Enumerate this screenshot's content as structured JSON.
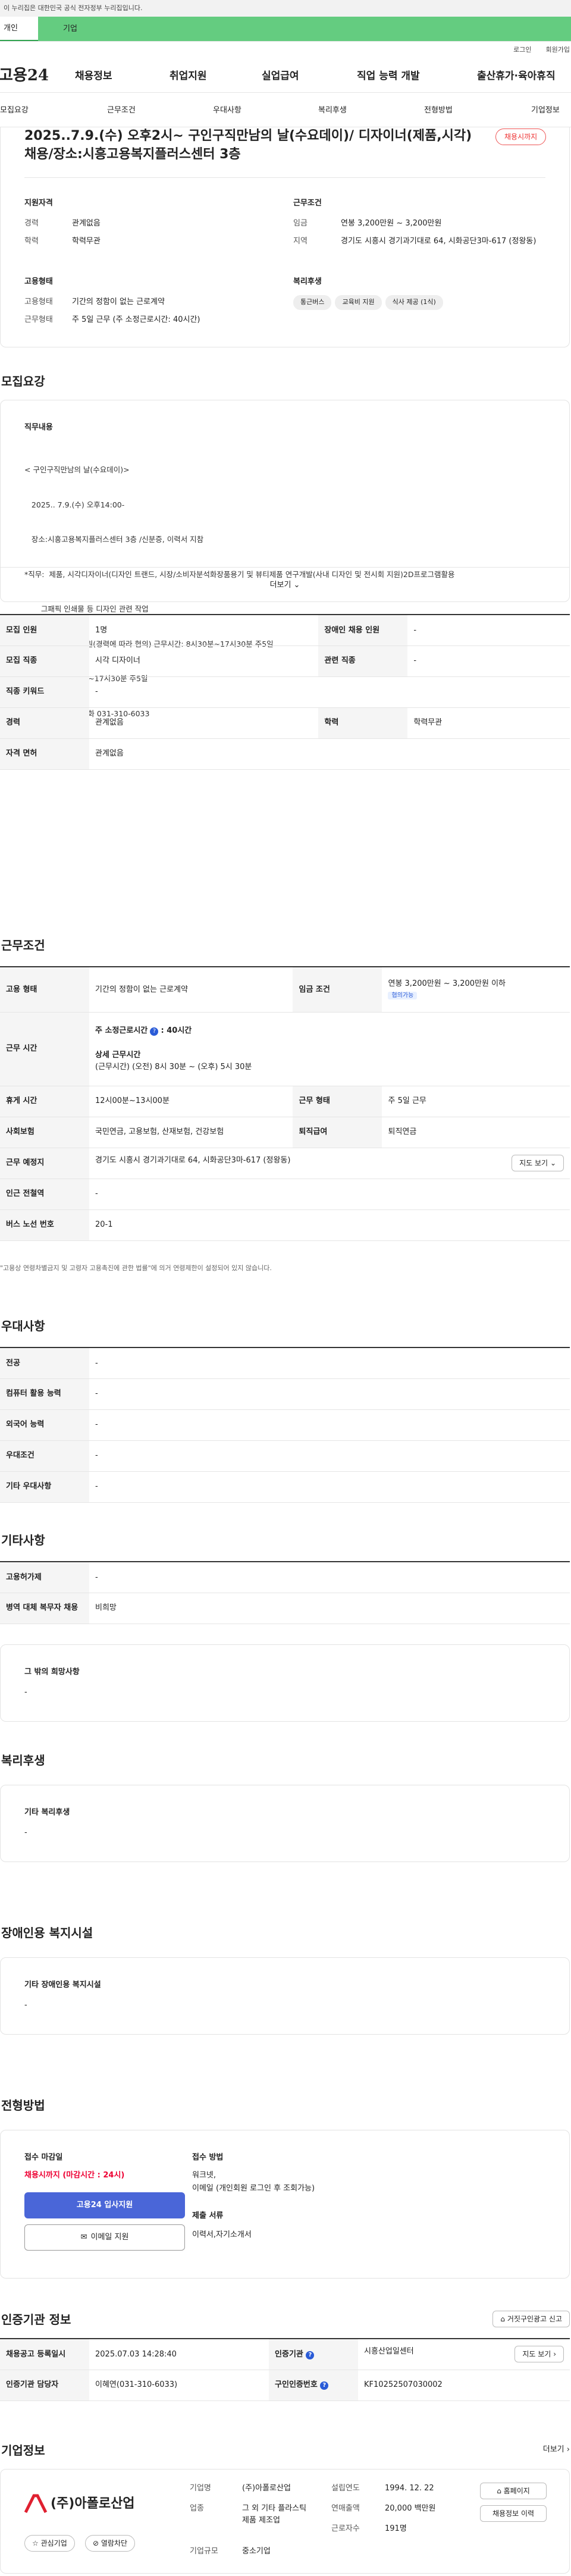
{
  "gov_banner": "이 누리집은 대한민국 공식 전자정부 누리집입니다.",
  "top_tabs": {
    "individual": "개인",
    "business": "기업"
  },
  "util": {
    "login": "로그인",
    "join": "회원가입"
  },
  "logo": "고용24",
  "gnb": [
    "채용정보",
    "취업지원",
    "실업급여",
    "직업 능력 개발",
    "출산휴가·육아휴직"
  ],
  "snb": [
    "모집요강",
    "근무조건",
    "우대사항",
    "복리후생",
    "전형방법",
    "기업정보"
  ],
  "summary": {
    "title": "2025..7.9.(수) 오후2시~ 구인구직만남의 날(수요데이)/ 디자이너(제품,시각) 채용/장소:시흥고용복지플러스센터 3층",
    "badge": "채용시까지",
    "qual_title": "지원자격",
    "qual": [
      {
        "k": "경력",
        "v": "관계없음"
      },
      {
        "k": "학력",
        "v": "학력무관"
      }
    ],
    "cond_title": "근무조건",
    "cond": [
      {
        "k": "임금",
        "v": "연봉 3,200만원 ~ 3,200만원"
      },
      {
        "k": "지역",
        "v": "경기도 시흥시 경기과기대로 64, 시화공단3마-617 (정왕동)"
      }
    ],
    "emp_title": "고용형태",
    "emp": [
      {
        "k": "고용형태",
        "v": "기간의 정함이 없는 근로계약"
      },
      {
        "k": "근무형태",
        "v": "주 5일 근무 (주 소정근로시간: 40시간)"
      }
    ],
    "welfare_title": "복리후생",
    "welfare_chips": [
      "통근버스",
      "교육비 지원",
      "식사 제공 (1식)"
    ]
  },
  "recruit": {
    "section": "모집요강",
    "duty_title": "직무내용",
    "duty_lines": [
      "< 구인구직만남의 날(수요데이)>",
      "   2025.. 7.9.(수) 오후14:00-",
      "   장소:시흥고용복지플러스센터 3층 /신분증, 이력서 지참",
      "*직무:  제품, 시각디자이너(디자인 트랜드, 시장/소비자분석화장품용기 및 뷰티제품 연구개발(사내 디자인 및 전시회 지원)2D프로그램활용",
      "       그패픽 인쇄물 등 디자인 관련 작업",
      "*급여: 연봉3200만원(경력에 따라 협의) 근무시간: 8시30분~17시30분 주5일",
      "*근무시간: 8시30분~17시30분 주5일",
      "*통근버스 유/문의전화 031-310-6033"
    ],
    "more": "더보기",
    "rows": [
      [
        "모집 인원",
        "1명",
        "장애인 채용 인원",
        "-"
      ],
      [
        "모집 직종",
        "시각 디자이너",
        "관련 직종",
        "-"
      ],
      [
        "직종 키워드",
        "-",
        "",
        ""
      ],
      [
        "경력",
        "관계없음",
        "학력",
        "학력무관"
      ],
      [
        "자격 면허",
        "관계없음",
        "",
        ""
      ]
    ]
  },
  "work": {
    "section": "근무조건",
    "employ_k": "고용 형태",
    "employ_v": "기간의 정함이 없는 근로계약",
    "wage_k": "임금 조건",
    "wage_v": "연봉 3,200만원 ~ 3,200만원 이하",
    "wage_tag": "협의가능",
    "time_k": "근무 시간",
    "time_main": "주 소정근로시간",
    "time_hours": ": 40시간",
    "time_detail_t": "상세 근무시간",
    "time_detail": "(근무시간) (오전) 8시 30분 ~ (오후) 5시 30분",
    "rest_k": "휴게 시간",
    "rest_v": "12시00분~13시00분",
    "form_k": "근무 형태",
    "form_v": "주 5일 근무",
    "ins_k": "사회보험",
    "ins_v": "국민연금, 고용보험, 산재보험, 건강보험",
    "ret_k": "퇴직급여",
    "ret_v": "퇴직연금",
    "place_k": "근무 예정지",
    "place_v": "경기도 시흥시 경기과기대로 64, 시화공단3마-617 (정왕동)",
    "map_btn": "지도 보기",
    "subway_k": "인근 전철역",
    "subway_v": "-",
    "bus_k": "버스 노선 번호",
    "bus_v": "20-1",
    "note": "\"고용상 연령차별금지 및 고령자 고용촉진에 관한 법률\"에 의거 연령제한이 설정되어 있지 않습니다."
  },
  "pref": {
    "section": "우대사항",
    "rows": [
      [
        "전공",
        "-"
      ],
      [
        "컴퓨터 활용 능력",
        "-"
      ],
      [
        "외국어 능력",
        "-"
      ],
      [
        "우대조건",
        "-"
      ],
      [
        "기타 우대사항",
        "-"
      ]
    ]
  },
  "etc": {
    "section": "기타사항",
    "rows": [
      [
        "고용허가제",
        "-"
      ],
      [
        "병역 대체 복무자 채용",
        "비희망"
      ]
    ],
    "wish_title": "그 밖의 희망사항",
    "wish_v": "-"
  },
  "welfare": {
    "section": "복리후생",
    "title": "기타 복리후생",
    "v": "-"
  },
  "disabled": {
    "section": "장애인용 복지시설",
    "title": "기타 장애인용 복지시설",
    "v": "-"
  },
  "screening": {
    "section": "전형방법",
    "deadline_t": "접수 마감일",
    "deadline_v": "채용시까지 (마감시간 : 24시)",
    "apply_btn": "고용24 입사지원",
    "email_btn": "이메일 지원",
    "method_t": "접수 방법",
    "method_v1": "워크넷,",
    "method_v2": "이메일 (개인회원 로그인 후 조회가능)",
    "docs_t": "제출 서류",
    "docs_v": "이력서,자기소개서"
  },
  "agency": {
    "section": "인증기관 정보",
    "report_btn": "거짓구인광고 신고",
    "rows": [
      {
        "k1": "채용공고 등록일시",
        "v1": "2025.07.03 14:28:40",
        "k2": "인증기관",
        "v2": "시흥산업일센터",
        "btn": "지도 보기"
      },
      {
        "k1": "인증기관 담당자",
        "v1": "이혜연(031-310-6033)",
        "k2": "구인인증번호",
        "v2": "KF10252507030002"
      }
    ]
  },
  "company": {
    "section": "기업정보",
    "more": "더보기",
    "name_logo": "(주)아폴로산업",
    "fav": "관심기업",
    "block": "열람차단",
    "fields": [
      {
        "k": "기업명",
        "v": "(주)아폴로산업"
      },
      {
        "k": "업종",
        "v": "그 외 기타 플라스틱 제품 제조업"
      },
      {
        "k": "기업규모",
        "v": "중소기업"
      }
    ],
    "fields2": [
      {
        "k": "설립연도",
        "v": "1994. 12. 22"
      },
      {
        "k": "연매출액",
        "v": "20,000 백만원"
      },
      {
        "k": "근로자수",
        "v": "191명"
      }
    ],
    "homepage_btn": "홈페이지",
    "list_btn": "채용정보 이력"
  },
  "colors": {
    "green": "#64cc80",
    "blue": "#4a66d8",
    "red": "#e02040"
  }
}
